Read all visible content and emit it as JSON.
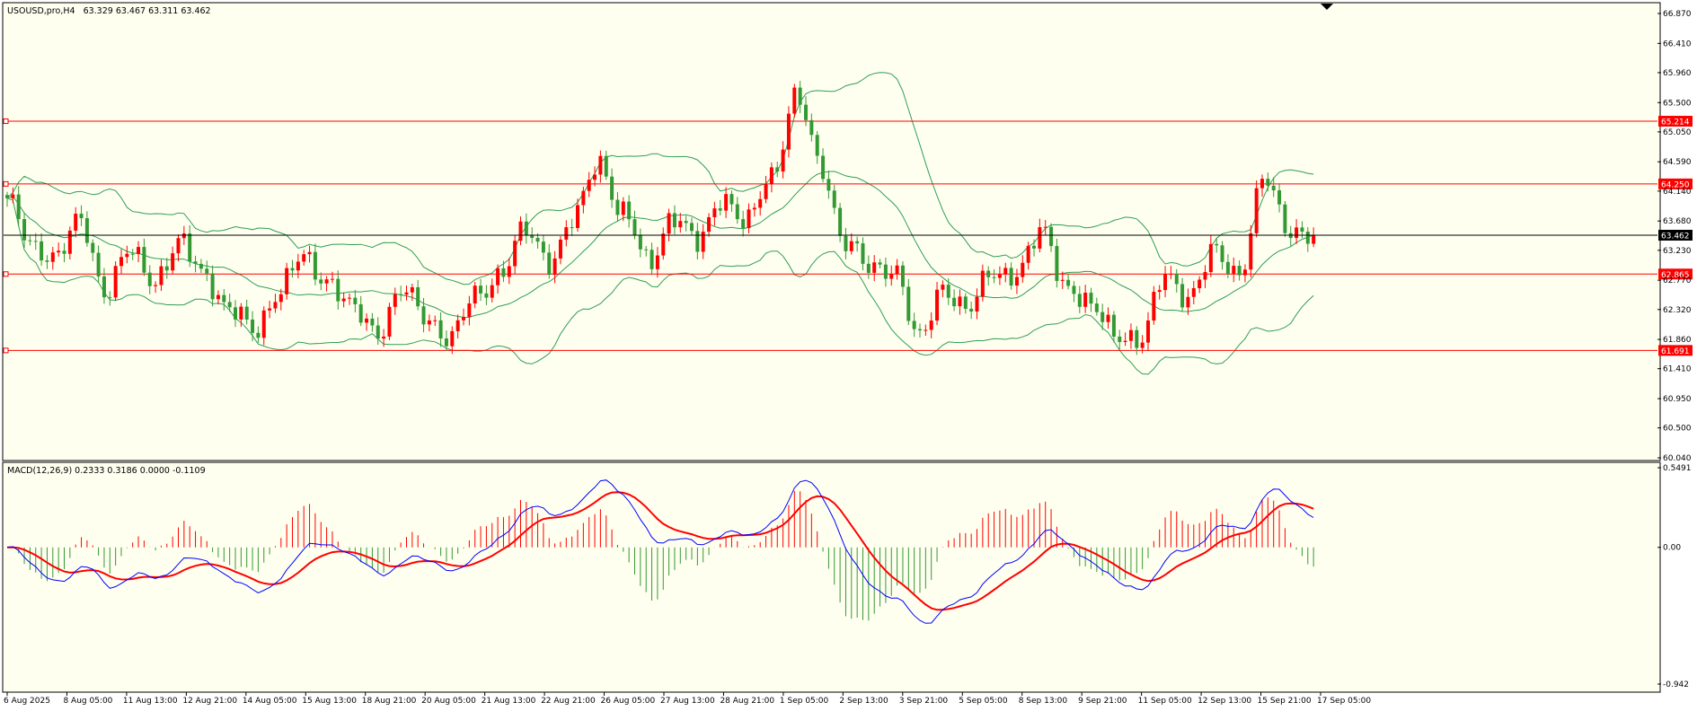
{
  "window": {
    "title": "USOUSD,pro,H4",
    "ohlc": "63.329 63.467 63.311 63.462"
  },
  "colors": {
    "background": "#fffff0",
    "bull": "#ff0000",
    "bear": "#339933",
    "bands": "#2e9e55",
    "macd_line": "#0000ff",
    "signal_line": "#ff0000",
    "level_line": "#ff0000",
    "price_line": "#000000"
  },
  "chart_data": [
    {
      "type": "candlestick",
      "title": "USOUSD,pro,H4",
      "ylim": [
        60.04,
        66.87
      ],
      "y_ticks": [
        "66.870",
        "66.410",
        "65.960",
        "65.500",
        "65.050",
        "64.590",
        "64.140",
        "63.680",
        "63.230",
        "62.770",
        "62.320",
        "61.860",
        "61.410",
        "60.950",
        "60.500",
        "60.040"
      ],
      "x_ticks": [
        "6 Aug 2025",
        "8 Aug 05:00",
        "11 Aug 13:00",
        "12 Aug 21:00",
        "14 Aug 05:00",
        "15 Aug 13:00",
        "18 Aug 21:00",
        "20 Aug 05:00",
        "21 Aug 13:00",
        "22 Aug 21:00",
        "26 Aug 05:00",
        "27 Aug 13:00",
        "28 Aug 21:00",
        "1 Sep 05:00",
        "2 Sep 13:00",
        "3 Sep 21:00",
        "5 Sep 05:00",
        "8 Sep 13:00",
        "9 Sep 21:00",
        "11 Sep 05:00",
        "12 Sep 13:00",
        "15 Sep 21:00",
        "17 Sep 05:00"
      ],
      "close_anchors": [
        63.95,
        63.35,
        63.1,
        63.7,
        62.6,
        63.2,
        62.8,
        63.3,
        62.9,
        62.3,
        62.0,
        62.6,
        63.1,
        62.8,
        62.3,
        62.0,
        62.6,
        62.2,
        61.9,
        62.5,
        62.9,
        63.5,
        63.1,
        63.7,
        64.6,
        63.8,
        63.0,
        63.8,
        63.3,
        64.1,
        63.6,
        64.4,
        65.6,
        64.5,
        63.4,
        62.9,
        63.0,
        61.8,
        62.7,
        62.3,
        62.9,
        62.9,
        63.5,
        62.7,
        62.3,
        62.0,
        61.8,
        62.9,
        62.5,
        63.2,
        62.9,
        64.3,
        63.6,
        63.4
      ],
      "last_close": 63.462,
      "levels": [
        {
          "value": 65.214,
          "label": "65.214"
        },
        {
          "value": 64.25,
          "label": "64.250"
        },
        {
          "value": 62.865,
          "label": "62.865"
        },
        {
          "value": 61.691,
          "label": "61.691"
        }
      ],
      "price_tag": "63.462",
      "bollinger": {
        "period": 20,
        "deviations": 2
      }
    },
    {
      "type": "macd",
      "title": "MACD(12,26,9) 0.2333 0.3186 0.0000 -0.1109",
      "params": [
        12,
        26,
        9
      ],
      "values": {
        "macd": 0.2333,
        "signal": 0.3186,
        "histogram_value": 0.0,
        "histogram_last": -0.1109
      },
      "ylim": [
        -0.942,
        0.5491
      ],
      "y_ticks": [
        "0.5491",
        "0.00",
        "-0.942"
      ]
    }
  ]
}
